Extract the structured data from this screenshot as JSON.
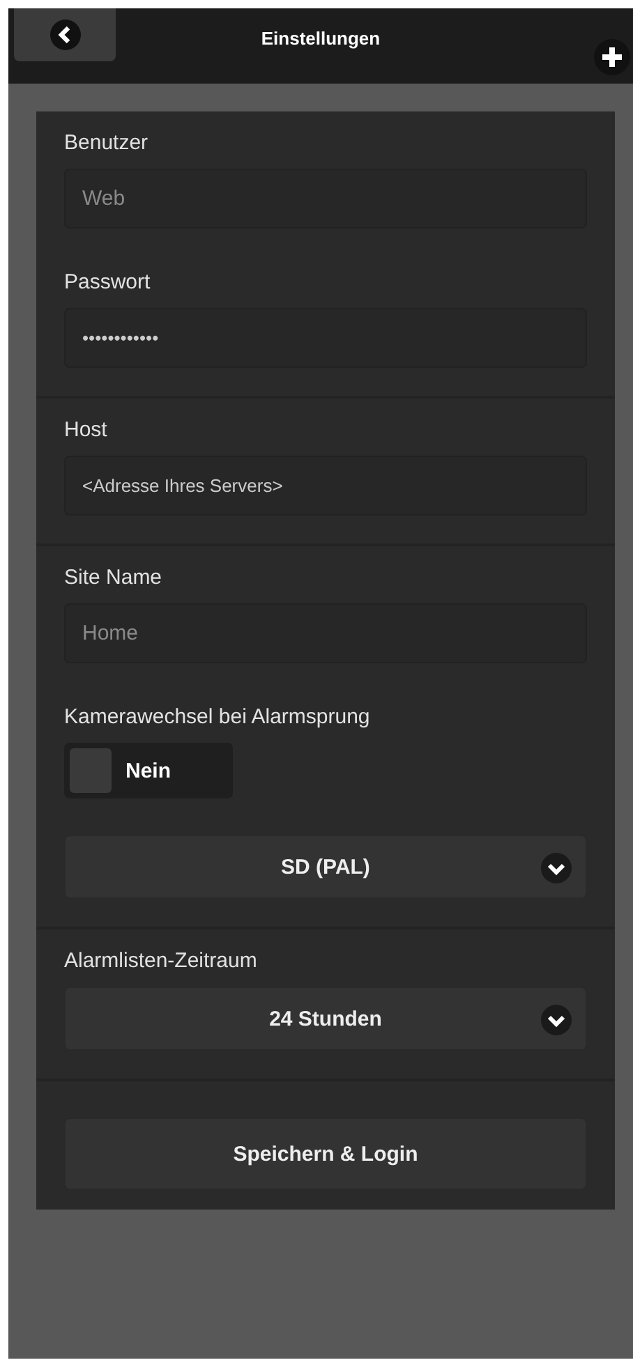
{
  "header": {
    "title": "Einstellungen"
  },
  "sections": [
    {
      "items": [
        {
          "kind": "field",
          "label": "Benutzer",
          "placeholder": "Web"
        },
        {
          "kind": "field",
          "label": "Passwort",
          "value": "••••••••••••"
        }
      ]
    },
    {
      "items": [
        {
          "kind": "field",
          "label": "Host",
          "value": "<Adresse Ihres Servers>"
        }
      ]
    },
    {
      "items": [
        {
          "kind": "field",
          "label": "Site Name",
          "placeholder": "Home"
        },
        {
          "kind": "toggle",
          "label": "Kamerawechsel bei Alarmsprung",
          "text": "Nein",
          "on": false
        },
        {
          "kind": "select",
          "value": "SD (PAL)"
        }
      ]
    },
    {
      "items": [
        {
          "kind": "select",
          "label": "Alarmlisten-Zeitraum",
          "value": "24 Stunden"
        }
      ]
    },
    {
      "items": [
        {
          "kind": "button",
          "text": "Speichern & Login"
        }
      ]
    }
  ]
}
